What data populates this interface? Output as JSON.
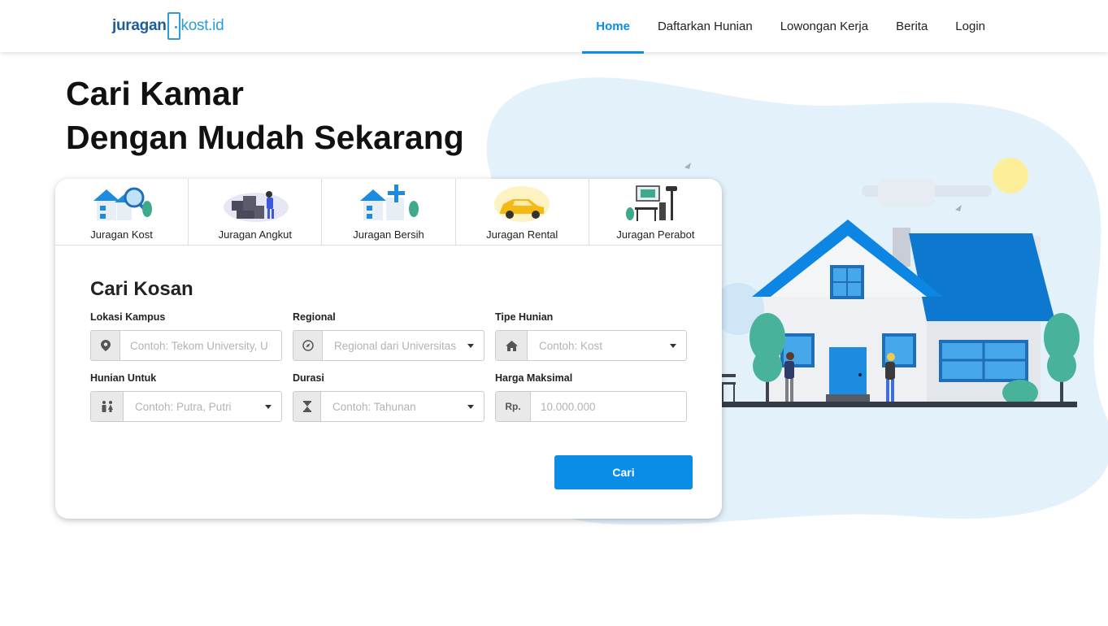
{
  "header": {
    "logo_left": "juragan",
    "logo_right": "kost.id",
    "nav": [
      {
        "label": "Home",
        "active": true
      },
      {
        "label": "Daftarkan Hunian",
        "active": false
      },
      {
        "label": "Lowongan Kerja",
        "active": false
      },
      {
        "label": "Berita",
        "active": false
      },
      {
        "label": "Login",
        "active": false
      }
    ]
  },
  "hero": {
    "title_line1": "Cari Kamar",
    "title_line2": "Dengan Mudah Sekarang"
  },
  "services": [
    {
      "label": "Juragan Kost",
      "icon": "house-search-icon"
    },
    {
      "label": "Juragan Angkut",
      "icon": "moving-boxes-icon"
    },
    {
      "label": "Juragan Bersih",
      "icon": "house-clean-icon"
    },
    {
      "label": "Juragan Rental",
      "icon": "car-icon"
    },
    {
      "label": "Juragan Perabot",
      "icon": "furniture-icon"
    }
  ],
  "form": {
    "title": "Cari Kosan",
    "lokasi": {
      "label": "Lokasi Kampus",
      "placeholder": "Contoh: Tekom University, U",
      "icon": "map-pin-icon"
    },
    "regional": {
      "label": "Regional",
      "placeholder": "Regional dari Universitas",
      "icon": "compass-icon"
    },
    "tipe": {
      "label": "Tipe Hunian",
      "placeholder": "Contoh: Kost",
      "icon": "home-icon"
    },
    "hunian": {
      "label": "Hunian Untuk",
      "placeholder": "Contoh: Putra, Putri",
      "icon": "people-icon"
    },
    "durasi": {
      "label": "Durasi",
      "placeholder": "Contoh: Tahunan",
      "icon": "hourglass-icon"
    },
    "harga": {
      "label": "Harga Maksimal",
      "prefix": "Rp.",
      "placeholder": "10.000.000"
    },
    "submit_label": "Cari"
  },
  "colors": {
    "primary": "#0a8de6",
    "brand_dark": "#1f5c99",
    "illustration_bg": "#e3f1fb"
  }
}
